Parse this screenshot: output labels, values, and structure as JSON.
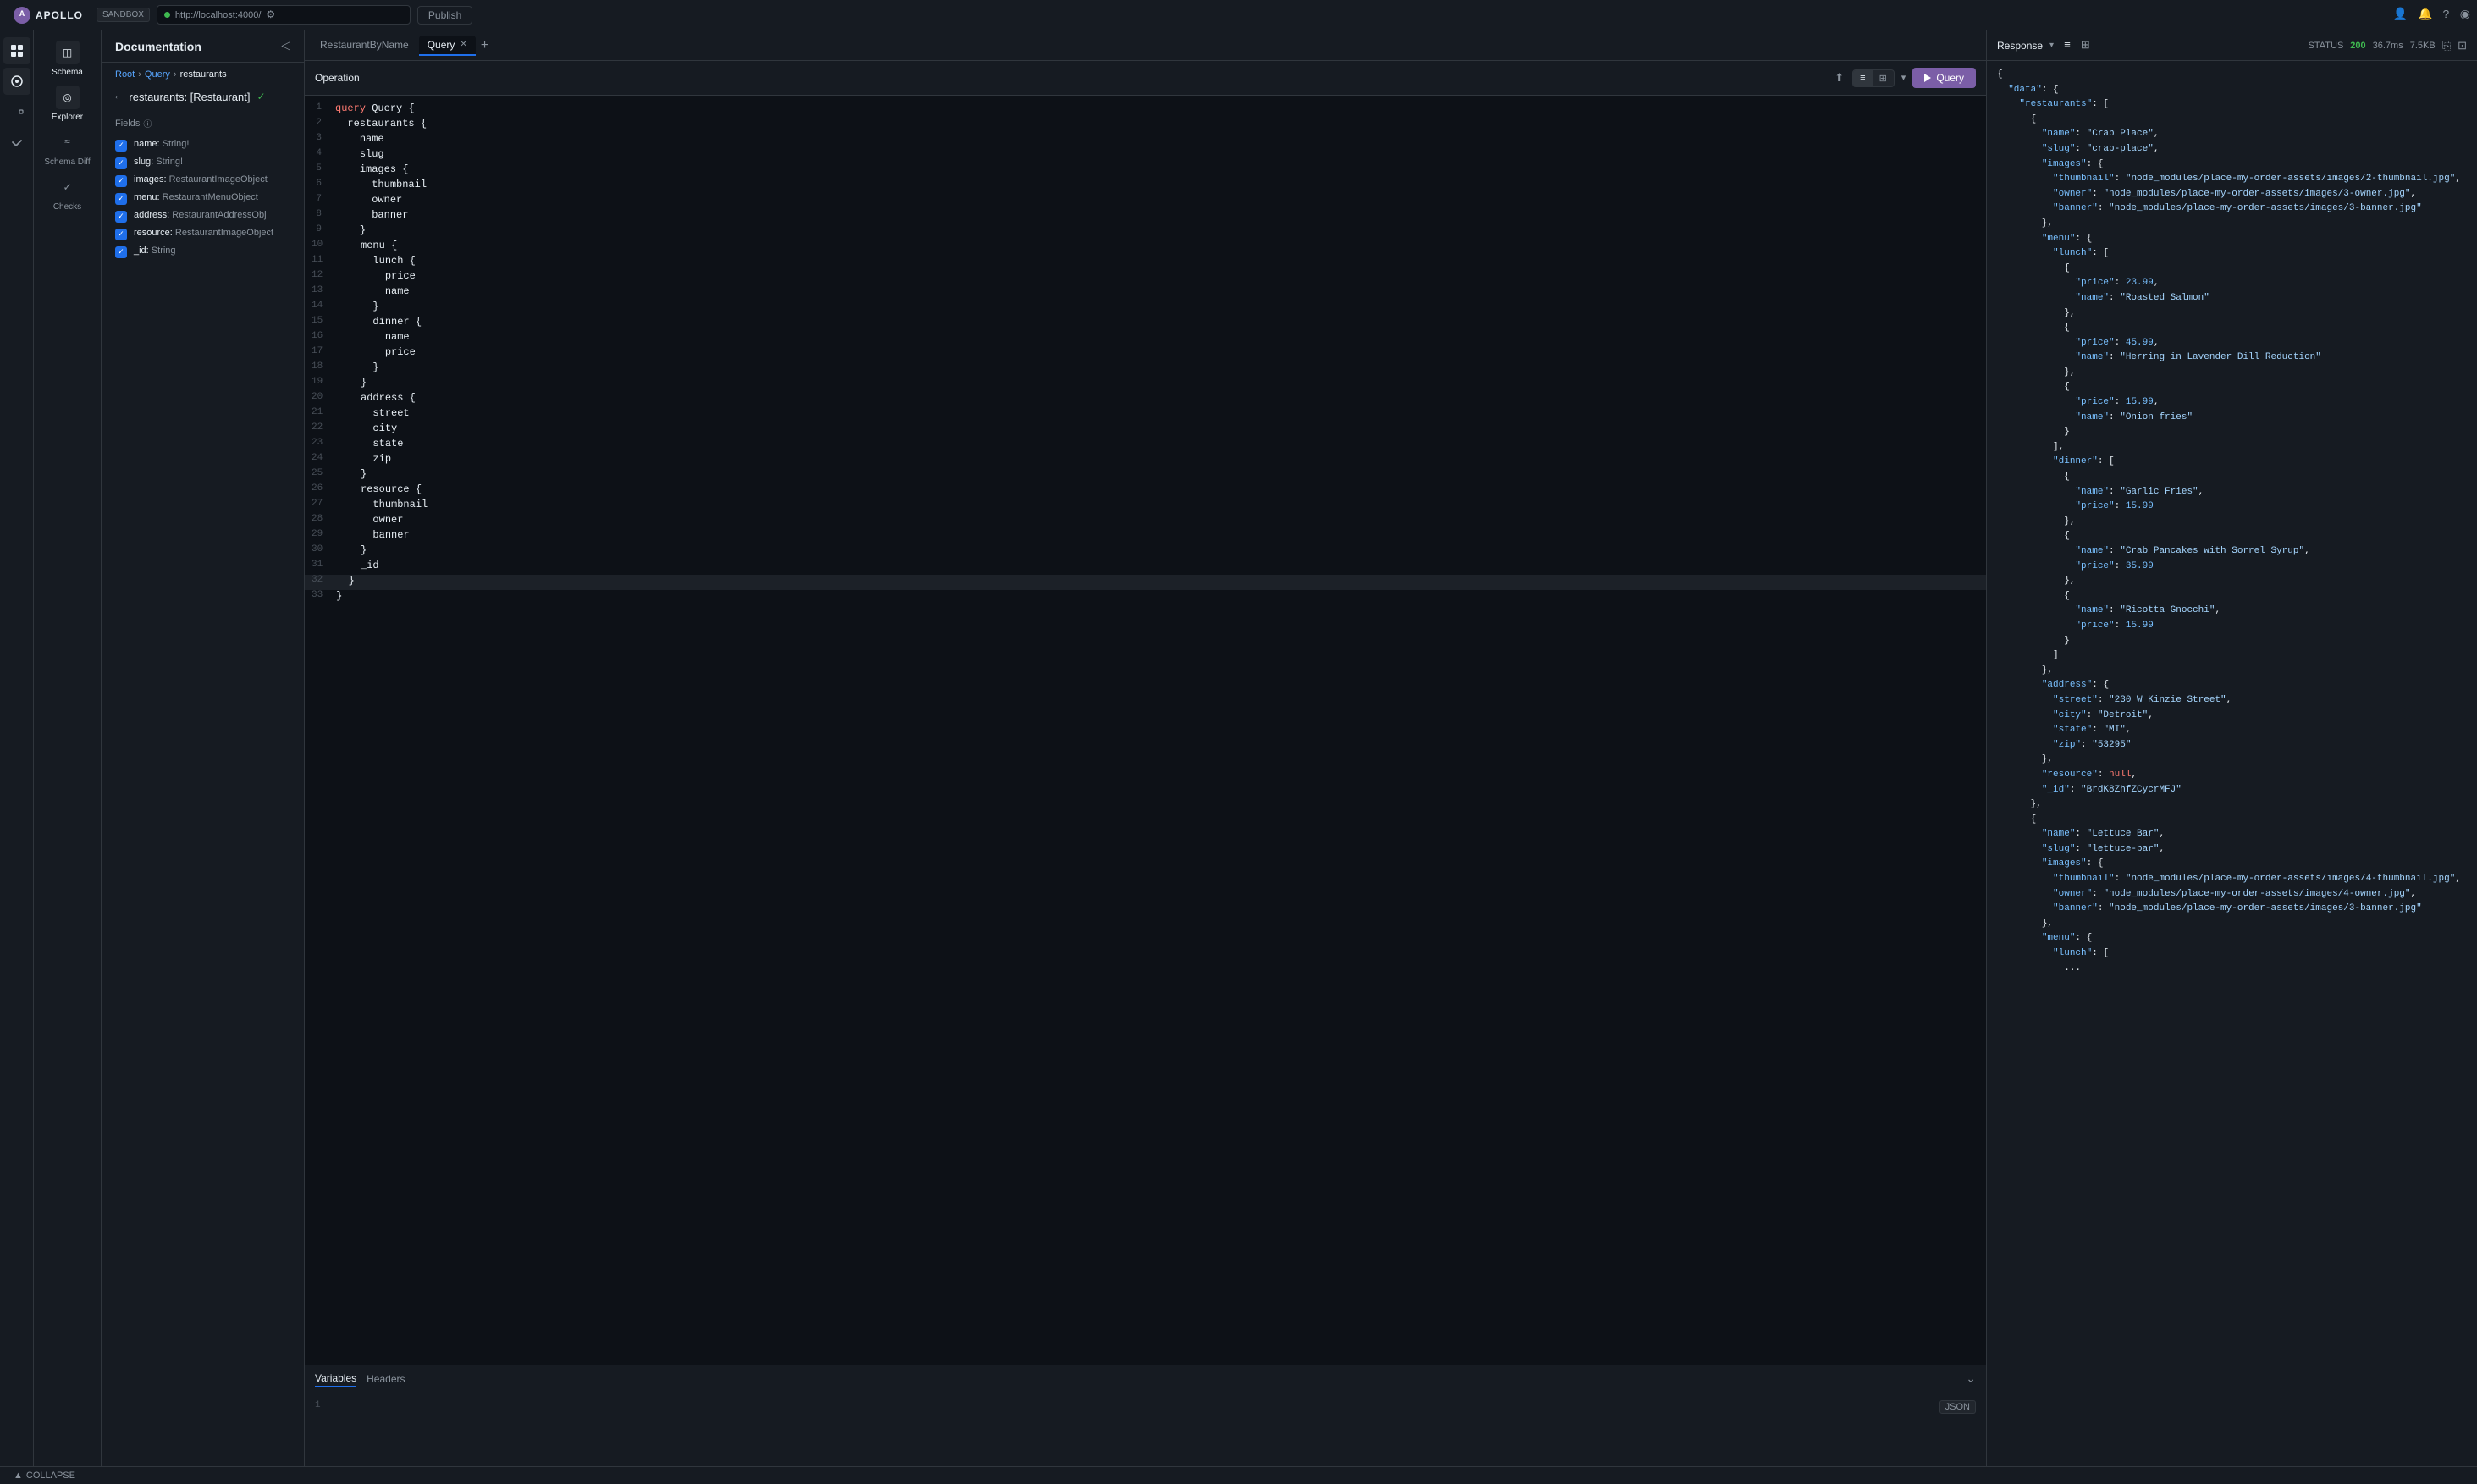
{
  "topbar": {
    "logo_text": "APOLLO",
    "sandbox_label": "SANDBOX",
    "url": "http://localhost:4000/",
    "publish_label": "Publish",
    "icons": {
      "settings": "⚙",
      "user": "👤",
      "bell": "🔔",
      "help": "?"
    }
  },
  "left_sidebar": {
    "items": [
      {
        "label": "Schema",
        "icon": "◫",
        "active": true
      },
      {
        "label": "Explorer",
        "icon": "◎",
        "active": true
      },
      {
        "label": "Schema Diff",
        "icon": "≈",
        "active": false
      },
      {
        "label": "Checks",
        "icon": "✓",
        "active": false
      }
    ]
  },
  "doc_panel": {
    "title": "Documentation",
    "breadcrumb": {
      "root": "Root",
      "sep1": "›",
      "query": "Query",
      "sep2": "›",
      "current": "restaurants"
    },
    "nav_back": "←",
    "doc_title": "restaurants: [Restaurant]",
    "verified_icon": "✓",
    "fields_header": "Fields",
    "fields": [
      {
        "name": "name:",
        "type": "String!"
      },
      {
        "name": "slug:",
        "type": "String!"
      },
      {
        "name": "images:",
        "type": "RestaurantImageObject"
      },
      {
        "name": "menu:",
        "type": "RestaurantMenuObject"
      },
      {
        "name": "address:",
        "type": "RestaurantAddressObj"
      },
      {
        "name": "resource:",
        "type": "RestaurantImageObject"
      },
      {
        "name": "_id:",
        "type": "String"
      }
    ]
  },
  "query_tabs": {
    "tabs": [
      {
        "label": "RestaurantByName",
        "active": false,
        "closeable": false
      },
      {
        "label": "Query",
        "active": true,
        "closeable": true
      }
    ],
    "add_icon": "+"
  },
  "operation": {
    "title": "Operation",
    "run_label": "Query",
    "code_lines": [
      {
        "num": 1,
        "text": "query Query {",
        "tokens": [
          {
            "t": "kw",
            "v": "query"
          },
          {
            "t": "field",
            "v": " Query "
          },
          {
            "t": "brace",
            "v": "{"
          }
        ]
      },
      {
        "num": 2,
        "text": "  restaurants {",
        "tokens": [
          {
            "t": "field",
            "v": "  restaurants "
          },
          {
            "t": "brace",
            "v": "{"
          }
        ]
      },
      {
        "num": 3,
        "text": "    name",
        "tokens": [
          {
            "t": "field",
            "v": "    name"
          }
        ]
      },
      {
        "num": 4,
        "text": "    slug",
        "tokens": [
          {
            "t": "field",
            "v": "    slug"
          }
        ]
      },
      {
        "num": 5,
        "text": "    images {",
        "tokens": [
          {
            "t": "field",
            "v": "    images "
          },
          {
            "t": "brace",
            "v": "{"
          }
        ]
      },
      {
        "num": 6,
        "text": "      thumbnail",
        "tokens": [
          {
            "t": "field",
            "v": "      thumbnail"
          }
        ]
      },
      {
        "num": 7,
        "text": "      owner",
        "tokens": [
          {
            "t": "field",
            "v": "      owner"
          }
        ]
      },
      {
        "num": 8,
        "text": "      banner",
        "tokens": [
          {
            "t": "field",
            "v": "      banner"
          }
        ]
      },
      {
        "num": 9,
        "text": "    }",
        "tokens": [
          {
            "t": "brace",
            "v": "    }"
          }
        ]
      },
      {
        "num": 10,
        "text": "    menu {",
        "tokens": [
          {
            "t": "field",
            "v": "    menu "
          },
          {
            "t": "brace",
            "v": "{"
          }
        ]
      },
      {
        "num": 11,
        "text": "      lunch {",
        "tokens": [
          {
            "t": "field",
            "v": "      lunch "
          },
          {
            "t": "brace",
            "v": "{"
          }
        ]
      },
      {
        "num": 12,
        "text": "        price",
        "tokens": [
          {
            "t": "field",
            "v": "        price"
          }
        ]
      },
      {
        "num": 13,
        "text": "        name",
        "tokens": [
          {
            "t": "field",
            "v": "        name"
          }
        ]
      },
      {
        "num": 14,
        "text": "      }",
        "tokens": [
          {
            "t": "brace",
            "v": "      }"
          }
        ]
      },
      {
        "num": 15,
        "text": "      dinner {",
        "tokens": [
          {
            "t": "field",
            "v": "      dinner "
          },
          {
            "t": "brace",
            "v": "{"
          }
        ]
      },
      {
        "num": 16,
        "text": "        name",
        "tokens": [
          {
            "t": "field",
            "v": "        name"
          }
        ]
      },
      {
        "num": 17,
        "text": "        price",
        "tokens": [
          {
            "t": "field",
            "v": "        price"
          }
        ]
      },
      {
        "num": 18,
        "text": "      }",
        "tokens": [
          {
            "t": "brace",
            "v": "      }"
          }
        ]
      },
      {
        "num": 19,
        "text": "    }",
        "tokens": [
          {
            "t": "brace",
            "v": "    }"
          }
        ]
      },
      {
        "num": 20,
        "text": "    address {",
        "tokens": [
          {
            "t": "field",
            "v": "    address "
          },
          {
            "t": "brace",
            "v": "{"
          }
        ]
      },
      {
        "num": 21,
        "text": "      street",
        "tokens": [
          {
            "t": "field",
            "v": "      street"
          }
        ]
      },
      {
        "num": 22,
        "text": "      city",
        "tokens": [
          {
            "t": "field",
            "v": "      city"
          }
        ]
      },
      {
        "num": 23,
        "text": "      state",
        "tokens": [
          {
            "t": "field",
            "v": "      state"
          }
        ]
      },
      {
        "num": 24,
        "text": "      zip",
        "tokens": [
          {
            "t": "field",
            "v": "      zip"
          }
        ]
      },
      {
        "num": 25,
        "text": "    }",
        "tokens": [
          {
            "t": "brace",
            "v": "    }"
          }
        ]
      },
      {
        "num": 26,
        "text": "    resource {",
        "tokens": [
          {
            "t": "field",
            "v": "    resource "
          },
          {
            "t": "brace",
            "v": "{"
          }
        ]
      },
      {
        "num": 27,
        "text": "      thumbnail",
        "tokens": [
          {
            "t": "field",
            "v": "      thumbnail"
          }
        ]
      },
      {
        "num": 28,
        "text": "      owner",
        "tokens": [
          {
            "t": "field",
            "v": "      owner"
          }
        ]
      },
      {
        "num": 29,
        "text": "      banner",
        "tokens": [
          {
            "t": "field",
            "v": "      banner"
          }
        ]
      },
      {
        "num": 30,
        "text": "    }",
        "tokens": [
          {
            "t": "brace",
            "v": "    }"
          }
        ]
      },
      {
        "num": 31,
        "text": "    _id",
        "tokens": [
          {
            "t": "field",
            "v": "    _id"
          }
        ]
      },
      {
        "num": 32,
        "text": "  }",
        "tokens": [
          {
            "t": "brace",
            "v": "  }"
          }
        ]
      },
      {
        "num": 33,
        "text": "}",
        "tokens": [
          {
            "t": "brace",
            "v": "}"
          }
        ]
      }
    ]
  },
  "variables": {
    "tab_variables": "Variables",
    "tab_headers": "Headers",
    "line_num": "1",
    "json_label": "JSON",
    "collapse_icon": "⌄"
  },
  "response": {
    "title": "Response",
    "status_label": "STATUS",
    "status_code": "200",
    "time": "36.7ms",
    "size": "7.5KB",
    "content": "{\n  \"data\": {\n    \"restaurants\": [\n      {\n        \"name\": \"Crab Place\",\n        \"slug\": \"crab-place\",\n        \"images\": {\n          \"thumbnail\": \"node_modules/place-my-order-assets/images/2-thumbnail.jpg\",\n          \"owner\": \"node_modules/place-my-order-assets/images/3-owner.jpg\",\n          \"banner\": \"node_modules/place-my-order-assets/images/3-banner.jpg\"\n        },\n        \"menu\": {\n          \"lunch\": [\n            {\n              \"price\": 23.99,\n              \"name\": \"Roasted Salmon\"\n            },\n            {\n              \"price\": 45.99,\n              \"name\": \"Herring in Lavender Dill Reduction\"\n            },\n            {\n              \"price\": 15.99,\n              \"name\": \"Onion fries\"\n            }\n          ],\n          \"dinner\": [\n            {\n              \"name\": \"Garlic Fries\",\n              \"price\": 15.99\n            },\n            {\n              \"name\": \"Crab Pancakes with Sorrel Syrup\",\n              \"price\": 35.99\n            },\n            {\n              \"name\": \"Ricotta Gnocchi\",\n              \"price\": 15.99\n            }\n          ]\n        },\n        \"address\": {\n          \"street\": \"230 W Kinzie Street\",\n          \"city\": \"Detroit\",\n          \"state\": \"MI\",\n          \"zip\": \"53295\"\n        },\n        \"resource\": null,\n        \"_id\": \"BrdK8ZhfZCycrMFJ\"\n      },\n      {\n        \"name\": \"Lettuce Bar\",\n        \"slug\": \"lettuce-bar\",\n        \"images\": {\n          \"thumbnail\": \"node_modules/place-my-order-assets/images/4-thumbnail.jpg\",\n          \"owner\": \"node_modules/place-my-order-assets/images/4-owner.jpg\",\n          \"banner\": \"node_modules/place-my-order-assets/images/3-banner.jpg\"\n        },\n        \"menu\": {\n          \"lunch\": [\n            ..."
  },
  "bottom": {
    "collapse_label": "COLLAPSE",
    "collapse_icon": "▲"
  }
}
